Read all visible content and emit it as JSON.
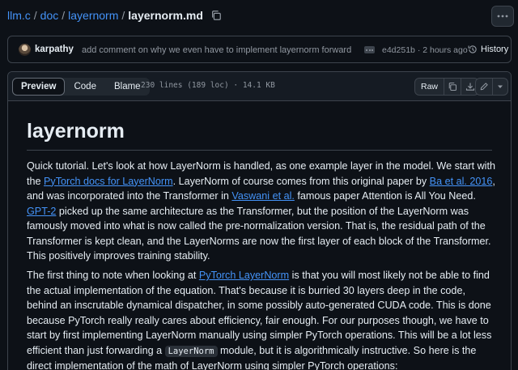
{
  "breadcrumb": {
    "repo": "llm.c",
    "folders": [
      "doc",
      "layernorm"
    ],
    "file": "layernorm.md",
    "separator": "/"
  },
  "commit": {
    "author": "karpathy",
    "message": "add comment on why we even have to implement layernorm forward ...",
    "sha": "e4d251b",
    "time": "2 hours ago",
    "meta_sep": "·",
    "history_label": "History"
  },
  "file_header": {
    "tabs": [
      "Preview",
      "Code",
      "Blame"
    ],
    "active_tab": "Preview",
    "info": "230 lines (189 loc) · 14.1 KB",
    "raw_label": "Raw"
  },
  "document": {
    "title": "layernorm",
    "p1": [
      {
        "t": "Quick tutorial. Let's look at how LayerNorm is handled, as one example layer in the model. We start with the "
      },
      {
        "link": "PyTorch docs for LayerNorm"
      },
      {
        "t": ". LayerNorm of course comes from this original paper by "
      },
      {
        "link": "Ba et al. 2016"
      },
      {
        "t": ", and was incorporated into the Transformer in "
      },
      {
        "link": "Vaswani et al."
      },
      {
        "t": " famous paper Attention is All You Need. "
      },
      {
        "link": "GPT-2"
      },
      {
        "t": " picked up the same architecture as the Transformer, but the position of the LayerNorm was famously moved into what is now called the pre-normalization version. That is, the residual path of the Transformer is kept clean, and the LayerNorms are now the first layer of each block of the Transformer. This positively improves training stability."
      }
    ],
    "p2": [
      {
        "t": "The first thing to note when looking at "
      },
      {
        "link": "PyTorch LayerNorm"
      },
      {
        "t": " is that you will most likely not be able to find the actual implementation of the equation. That's because it is burried 30 layers deep in the code, behind an inscrutable dynamical dispatcher, in some possibly auto-generated CUDA code. This is done because PyTorch really really cares about efficiency, fair enough. For our purposes though, we have to start by first implementing LayerNorm manually using simpler PyTorch operations. This will be a lot less efficient than just forwarding a "
      },
      {
        "code": "LayerNorm"
      },
      {
        "t": " module, but it is algorithmically instructive. So here is the direct implementation of the math of LayerNorm using simpler PyTorch operations:"
      }
    ]
  },
  "colors": {
    "background": "#0d1117",
    "link": "#4493f8",
    "text": "#e6edf3",
    "muted": "#9198a1",
    "border": "#3d444d"
  },
  "icons": [
    "copy-icon",
    "kebab-icon",
    "history-icon",
    "copy-raw-icon",
    "download-icon",
    "pencil-icon",
    "triangle-down-icon"
  ]
}
